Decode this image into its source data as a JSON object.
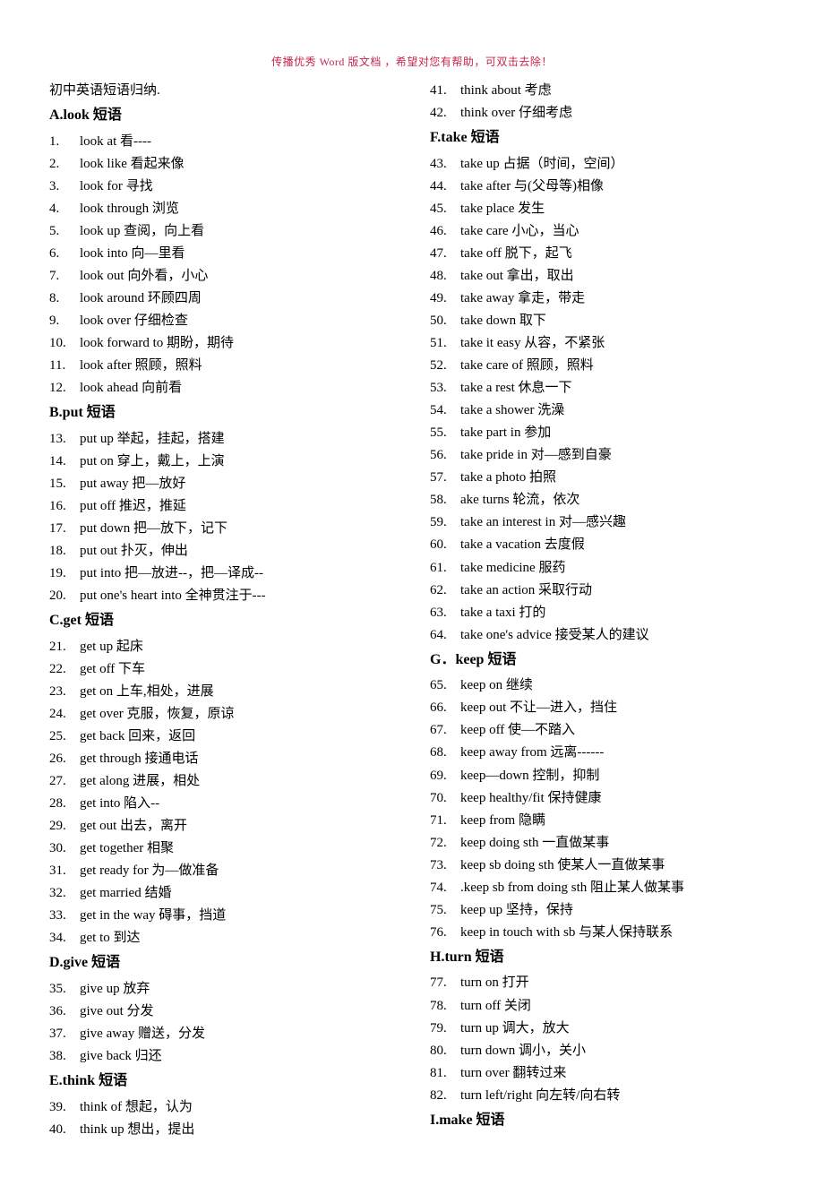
{
  "header_notice": "传播优秀 Word 版文档 ，希望对您有帮助，可双击去除！",
  "doc_title": "初中英语短语归纳.",
  "left_column": [
    {
      "type": "section",
      "text": "A.look 短语"
    },
    {
      "type": "item",
      "num": "1.",
      "text": "look at 看----"
    },
    {
      "type": "item",
      "num": "2.",
      "text": "look like 看起来像"
    },
    {
      "type": "item",
      "num": "3.",
      "text": "look for 寻找"
    },
    {
      "type": "item",
      "num": "4.",
      "text": "look through 浏览"
    },
    {
      "type": "item",
      "num": "5.",
      "text": "look up 查阅，向上看"
    },
    {
      "type": "item",
      "num": "6.",
      "text": "look into 向—里看"
    },
    {
      "type": "item",
      "num": "7.",
      "text": "look out 向外看，小心"
    },
    {
      "type": "item",
      "num": "8.",
      "text": "look around 环顾四周"
    },
    {
      "type": "item",
      "num": "9.",
      "text": "look over 仔细检查"
    },
    {
      "type": "item",
      "num": "10.",
      "text": "look forward to 期盼，期待"
    },
    {
      "type": "item",
      "num": "11.",
      "text": "look after 照顾，照料"
    },
    {
      "type": "item",
      "num": "12.",
      "text": "look ahead 向前看"
    },
    {
      "type": "section",
      "text": "B.put 短语"
    },
    {
      "type": "item",
      "num": "13.",
      "text": "put up 举起，挂起，搭建"
    },
    {
      "type": "item",
      "num": "14.",
      "text": "put on 穿上，戴上，上演"
    },
    {
      "type": "item",
      "num": "15.",
      "text": "put away 把—放好"
    },
    {
      "type": "item",
      "num": "16.",
      "text": "put off 推迟，推延"
    },
    {
      "type": "item",
      "num": "17.",
      "text": "put down 把—放下，记下"
    },
    {
      "type": "item",
      "num": "18.",
      "text": "put out 扑灭，伸出"
    },
    {
      "type": "item",
      "num": "19.",
      "text": "put into 把—放进--，把—译成--"
    },
    {
      "type": "item",
      "num": "20.",
      "text": "put one's heart into 全神贯注于---"
    },
    {
      "type": "section",
      "text": "C.get 短语"
    },
    {
      "type": "item",
      "num": "21.",
      "text": "get up 起床"
    },
    {
      "type": "item",
      "num": "22.",
      "text": "get off 下车"
    },
    {
      "type": "item",
      "num": "23.",
      "text": "get on 上车,相处，进展"
    },
    {
      "type": "item",
      "num": "24.",
      "text": "get over 克服，恢复，原谅"
    },
    {
      "type": "item",
      "num": "25.",
      "text": "get back 回来，返回"
    },
    {
      "type": "item",
      "num": "26.",
      "text": "get through 接通电话"
    },
    {
      "type": "item",
      "num": "27.",
      "text": "get along 进展，相处"
    },
    {
      "type": "item",
      "num": "28.",
      "text": "get into 陷入--"
    },
    {
      "type": "item",
      "num": "29.",
      "text": "get out 出去，离开"
    },
    {
      "type": "item",
      "num": "30.",
      "text": "get together 相聚"
    },
    {
      "type": "item",
      "num": "31.",
      "text": "get ready for 为—做准备"
    },
    {
      "type": "item",
      "num": "32.",
      "text": "get married 结婚"
    },
    {
      "type": "item",
      "num": "33.",
      "text": "get in the way 碍事，挡道"
    },
    {
      "type": "item",
      "num": "34.",
      "text": "get to 到达"
    },
    {
      "type": "section",
      "text": "D.give 短语"
    },
    {
      "type": "item",
      "num": "35.",
      "text": "give up 放弃"
    },
    {
      "type": "item",
      "num": "36.",
      "text": "give out 分发"
    },
    {
      "type": "item",
      "num": "37.",
      "text": "give away 赠送，分发"
    },
    {
      "type": "item",
      "num": "38.",
      "text": "give back 归还"
    },
    {
      "type": "section",
      "text": "E.think 短语"
    },
    {
      "type": "item",
      "num": "39.",
      "text": "think of 想起，认为"
    },
    {
      "type": "item",
      "num": "40.",
      "text": "think up 想出，提出"
    }
  ],
  "right_column": [
    {
      "type": "item",
      "num": "41.",
      "text": "think about 考虑"
    },
    {
      "type": "item",
      "num": "42.",
      "text": "think over 仔细考虑"
    },
    {
      "type": "section",
      "text": "F.take 短语"
    },
    {
      "type": "item",
      "num": "43.",
      "text": "take up 占据（时间，空间）"
    },
    {
      "type": "item",
      "num": "44.",
      "text": "take after 与(父母等)相像"
    },
    {
      "type": "item",
      "num": "45.",
      "text": "take place 发生"
    },
    {
      "type": "item",
      "num": "46.",
      "text": "take care 小心，当心"
    },
    {
      "type": "item",
      "num": "47.",
      "text": "take off 脱下，起飞"
    },
    {
      "type": "item",
      "num": "48.",
      "text": "take out 拿出，取出"
    },
    {
      "type": "item",
      "num": "49.",
      "text": "take away 拿走，带走"
    },
    {
      "type": "item",
      "num": "50.",
      "text": "take down 取下"
    },
    {
      "type": "item",
      "num": "51.",
      "text": "take it easy 从容，不紧张"
    },
    {
      "type": "item",
      "num": "52.",
      "text": "take care of 照顾，照料"
    },
    {
      "type": "item",
      "num": "53.",
      "text": "take a rest 休息一下"
    },
    {
      "type": "item",
      "num": "54.",
      "text": "take a shower 洗澡"
    },
    {
      "type": "item",
      "num": "55.",
      "text": "take part in 参加"
    },
    {
      "type": "item",
      "num": "56.",
      "text": "take pride in 对—感到自豪"
    },
    {
      "type": "item",
      "num": "57.",
      "text": "take a photo 拍照"
    },
    {
      "type": "item",
      "num": "58.",
      "text": "ake turns 轮流，依次"
    },
    {
      "type": "item",
      "num": "59.",
      "text": "take an interest in 对—感兴趣"
    },
    {
      "type": "item",
      "num": "60.",
      "text": "take a vacation 去度假"
    },
    {
      "type": "item",
      "num": "61.",
      "text": "take medicine 服药"
    },
    {
      "type": "item",
      "num": "62.",
      "text": "take an action 采取行动"
    },
    {
      "type": "item",
      "num": "63.",
      "text": "take a taxi 打的"
    },
    {
      "type": "item",
      "num": "64.",
      "text": "take one's advice 接受某人的建议"
    },
    {
      "type": "section",
      "text": "G．keep 短语"
    },
    {
      "type": "item",
      "num": "65.",
      "text": "keep on 继续"
    },
    {
      "type": "item",
      "num": "66.",
      "text": "keep out 不让—进入，挡住"
    },
    {
      "type": "item",
      "num": "67.",
      "text": "keep off 使—不踏入"
    },
    {
      "type": "item",
      "num": "68.",
      "text": "keep away from 远离------"
    },
    {
      "type": "item",
      "num": "69.",
      "text": "keep—down 控制，抑制"
    },
    {
      "type": "item",
      "num": "70.",
      "text": "keep healthy/fit 保持健康"
    },
    {
      "type": "item",
      "num": "71.",
      "text": "keep from 隐瞒"
    },
    {
      "type": "item",
      "num": "72.",
      "text": "keep doing sth 一直做某事"
    },
    {
      "type": "item",
      "num": "73.",
      "text": "keep sb doing sth 使某人一直做某事"
    },
    {
      "type": "item",
      "num": "74.",
      "text": ".keep sb from doing sth 阻止某人做某事"
    },
    {
      "type": "item",
      "num": "75.",
      "text": "keep up 坚持，保持"
    },
    {
      "type": "item",
      "num": "76.",
      "text": "keep in touch with sb 与某人保持联系"
    },
    {
      "type": "section",
      "text": "H.turn 短语"
    },
    {
      "type": "item",
      "num": "77.",
      "text": "turn on 打开"
    },
    {
      "type": "item",
      "num": "78.",
      "text": "turn off 关闭"
    },
    {
      "type": "item",
      "num": "79.",
      "text": "turn up 调大，放大"
    },
    {
      "type": "item",
      "num": "80.",
      "text": "turn down 调小，关小"
    },
    {
      "type": "item",
      "num": "81.",
      "text": "turn over 翻转过来"
    },
    {
      "type": "item",
      "num": "82.",
      "text": "turn left/right 向左转/向右转"
    },
    {
      "type": "section",
      "text": "I.make 短语"
    }
  ]
}
